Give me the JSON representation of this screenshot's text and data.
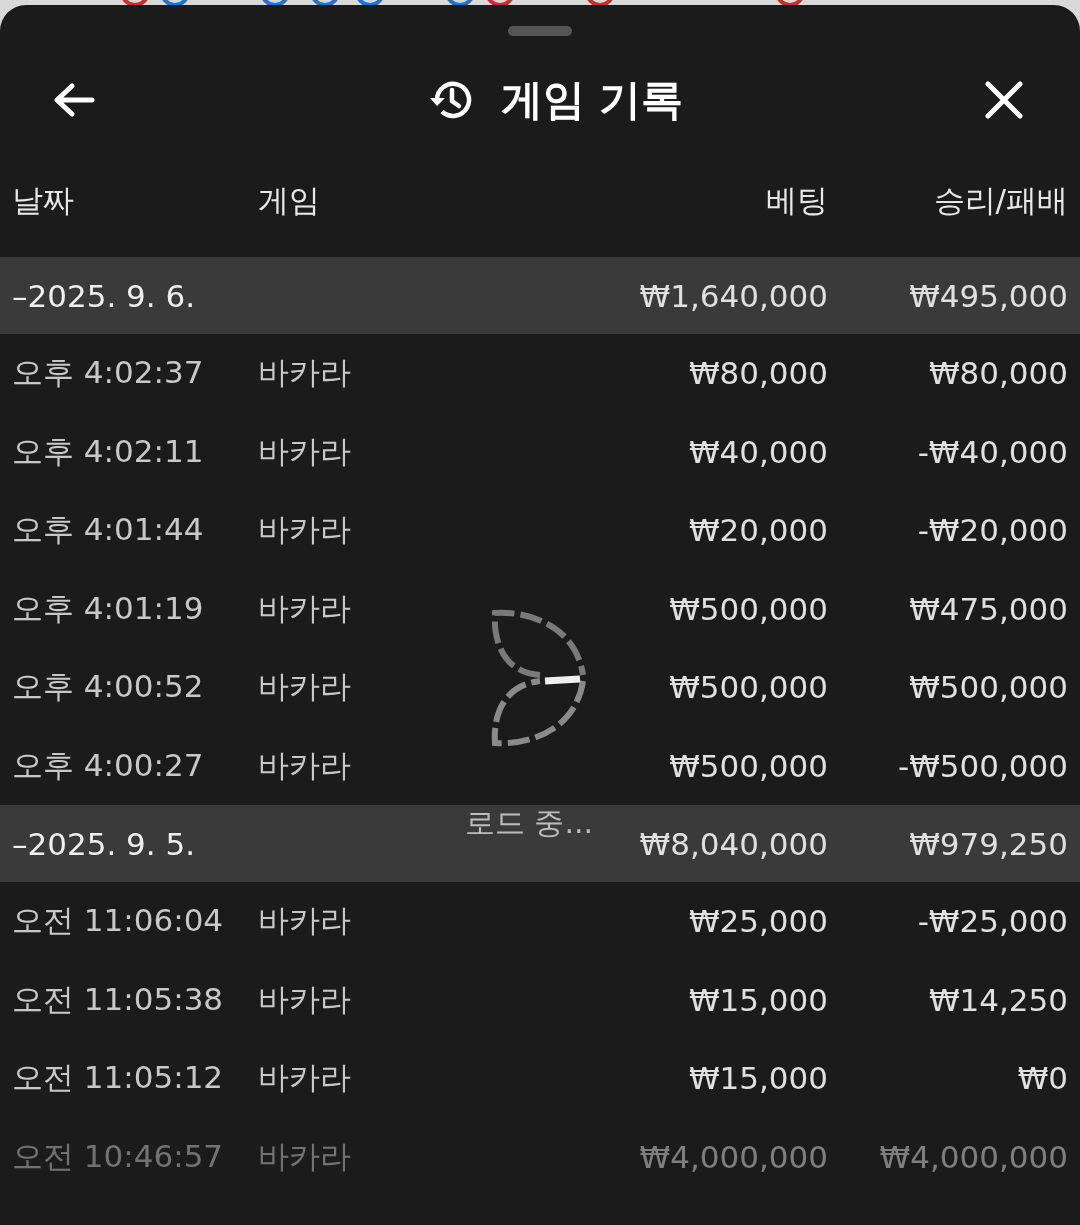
{
  "title": "게임 기록",
  "columns": [
    "날짜",
    "게임",
    "베팅",
    "승리/패배"
  ],
  "groups": [
    {
      "label": "–2025. 9. 6.",
      "bet": "₩1,640,000",
      "result": "₩495,000",
      "rows": [
        {
          "time": "오후 4:02:37",
          "game": "바카라",
          "bet": "₩80,000",
          "result": "₩80,000",
          "faded": false
        },
        {
          "time": "오후 4:02:11",
          "game": "바카라",
          "bet": "₩40,000",
          "result": "-₩40,000",
          "faded": false
        },
        {
          "time": "오후 4:01:44",
          "game": "바카라",
          "bet": "₩20,000",
          "result": "-₩20,000",
          "faded": false
        },
        {
          "time": "오후 4:01:19",
          "game": "바카라",
          "bet": "₩500,000",
          "result": "₩475,000",
          "faded": false
        },
        {
          "time": "오후 4:00:52",
          "game": "바카라",
          "bet": "₩500,000",
          "result": "₩500,000",
          "faded": false
        },
        {
          "time": "오후 4:00:27",
          "game": "바카라",
          "bet": "₩500,000",
          "result": "-₩500,000",
          "faded": false
        }
      ]
    },
    {
      "label": "–2025. 9. 5.",
      "bet": "₩8,040,000",
      "result": "₩979,250",
      "rows": [
        {
          "time": "오전 11:06:04",
          "game": "바카라",
          "bet": "₩25,000",
          "result": "-₩25,000",
          "faded": false
        },
        {
          "time": "오전 11:05:38",
          "game": "바카라",
          "bet": "₩15,000",
          "result": "₩14,250",
          "faded": false
        },
        {
          "time": "오전 11:05:12",
          "game": "바카라",
          "bet": "₩15,000",
          "result": "₩0",
          "faded": false
        },
        {
          "time": "오전 10:46:57",
          "game": "바카라",
          "bet": "₩4,000,000",
          "result": "₩4,000,000",
          "faded": true
        }
      ]
    }
  ],
  "loading": {
    "label": "로드 중..."
  }
}
